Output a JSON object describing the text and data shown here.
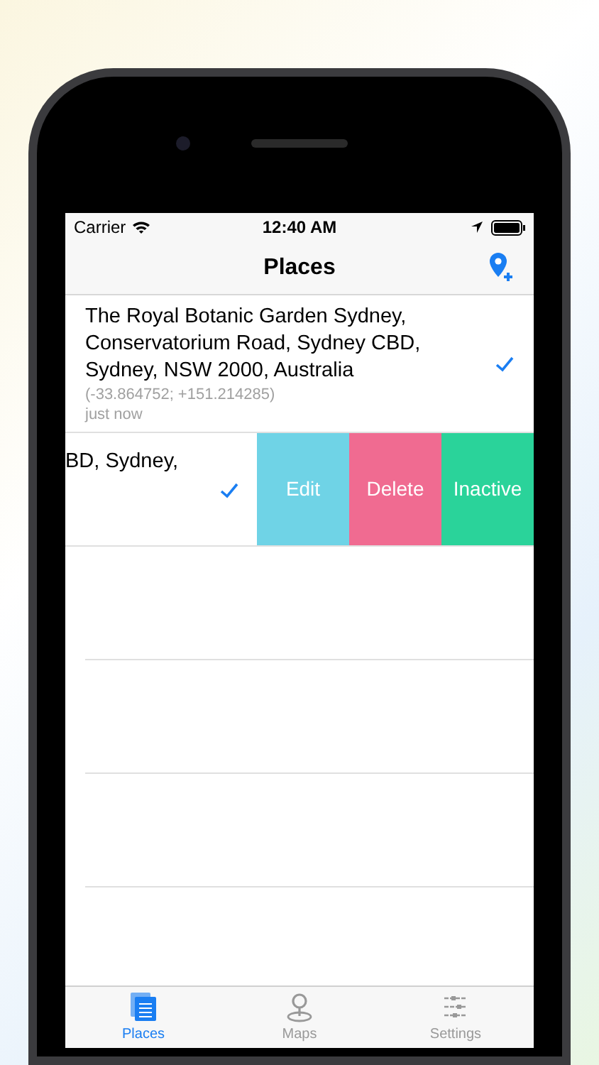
{
  "status_bar": {
    "carrier": "Carrier",
    "time": "12:40 AM"
  },
  "nav_bar": {
    "title": "Places"
  },
  "places": [
    {
      "name": "The Royal Botanic Garden Sydney, Conservatorium Road, Sydney CBD, Sydney, NSW 2000, Australia",
      "coordinates": "(-33.864752; +151.214285)",
      "time": "just now",
      "checked": true
    }
  ],
  "swiped_row": {
    "name": "BD, Sydney,",
    "checked": true,
    "actions": [
      {
        "label": "Edit",
        "color": "#6fd3e6"
      },
      {
        "label": "Delete",
        "color": "#f06b91"
      },
      {
        "label": "Inactive",
        "color": "#2ad39a"
      }
    ]
  },
  "tabs": [
    {
      "label": "Places",
      "selected": true
    },
    {
      "label": "Maps",
      "selected": false
    },
    {
      "label": "Settings",
      "selected": false
    }
  ]
}
